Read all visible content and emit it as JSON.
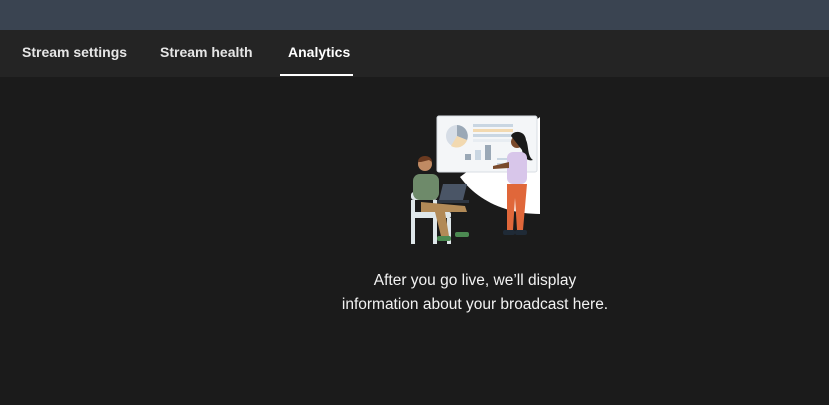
{
  "tabs": [
    {
      "label": "Stream settings",
      "active": false
    },
    {
      "label": "Stream health",
      "active": false
    },
    {
      "label": "Analytics",
      "active": true
    }
  ],
  "empty_state": {
    "illustration_icon": "analytics-presentation-illustration",
    "line1": "After you go live, we’ll display",
    "line2": "information about your broadcast here."
  },
  "colors": {
    "top_strip": "#3a4451",
    "tabbar_bg": "#242424",
    "page_bg": "#1b1b1b",
    "text": "#f2f2f2"
  }
}
